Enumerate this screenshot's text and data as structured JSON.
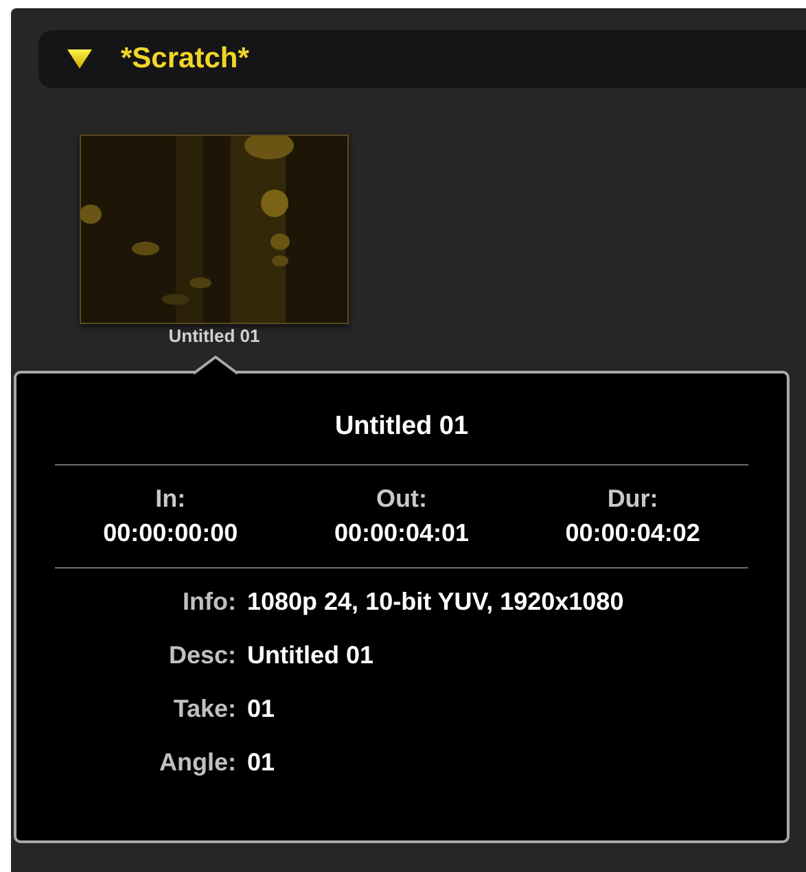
{
  "bin": {
    "title": "*Scratch*",
    "expanded": true
  },
  "clips": [
    {
      "name": "Untitled 01"
    }
  ],
  "popover": {
    "title": "Untitled 01",
    "timecodes": [
      {
        "label": "In:",
        "value": "00:00:00:00"
      },
      {
        "label": "Out:",
        "value": "00:00:04:01"
      },
      {
        "label": "Dur:",
        "value": "00:00:04:02"
      }
    ],
    "details": [
      {
        "label": "Info:",
        "value": "1080p 24, 10-bit YUV, 1920x1080"
      },
      {
        "label": "Desc:",
        "value": "Untitled 01"
      },
      {
        "label": "Take:",
        "value": "01"
      },
      {
        "label": "Angle:",
        "value": "01"
      }
    ]
  }
}
